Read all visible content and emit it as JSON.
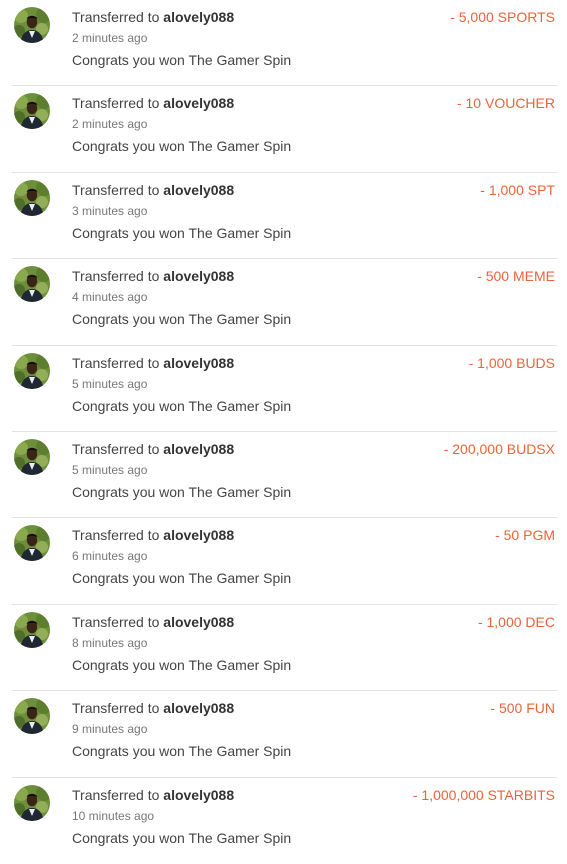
{
  "transfers": [
    {
      "prefix": "Transferred to",
      "user": "alovely088",
      "time": "2 minutes ago",
      "memo": "Congrats you won The Gamer Spin",
      "amount": "- 5,000 SPORTS"
    },
    {
      "prefix": "Transferred to",
      "user": "alovely088",
      "time": "2 minutes ago",
      "memo": "Congrats you won The Gamer Spin",
      "amount": "- 10 VOUCHER"
    },
    {
      "prefix": "Transferred to",
      "user": "alovely088",
      "time": "3 minutes ago",
      "memo": "Congrats you won The Gamer Spin",
      "amount": "- 1,000 SPT"
    },
    {
      "prefix": "Transferred to",
      "user": "alovely088",
      "time": "4 minutes ago",
      "memo": "Congrats you won The Gamer Spin",
      "amount": "- 500 MEME"
    },
    {
      "prefix": "Transferred to",
      "user": "alovely088",
      "time": "5 minutes ago",
      "memo": "Congrats you won The Gamer Spin",
      "amount": "- 1,000 BUDS"
    },
    {
      "prefix": "Transferred to",
      "user": "alovely088",
      "time": "5 minutes ago",
      "memo": "Congrats you won The Gamer Spin",
      "amount": "- 200,000 BUDSX"
    },
    {
      "prefix": "Transferred to",
      "user": "alovely088",
      "time": "6 minutes ago",
      "memo": "Congrats you won The Gamer Spin",
      "amount": "- 50 PGM"
    },
    {
      "prefix": "Transferred to",
      "user": "alovely088",
      "time": "8 minutes ago",
      "memo": "Congrats you won The Gamer Spin",
      "amount": "- 1,000 DEC"
    },
    {
      "prefix": "Transferred to",
      "user": "alovely088",
      "time": "9 minutes ago",
      "memo": "Congrats you won The Gamer Spin",
      "amount": "- 500 FUN"
    },
    {
      "prefix": "Transferred to",
      "user": "alovely088",
      "time": "10 minutes ago",
      "memo": "Congrats you won The Gamer Spin",
      "amount": "- 1,000,000 STARBITS"
    }
  ],
  "colors": {
    "amount": "#e8643a",
    "divider": "#e3e3e3"
  },
  "icons": {
    "avatar": "user-avatar-photo"
  }
}
